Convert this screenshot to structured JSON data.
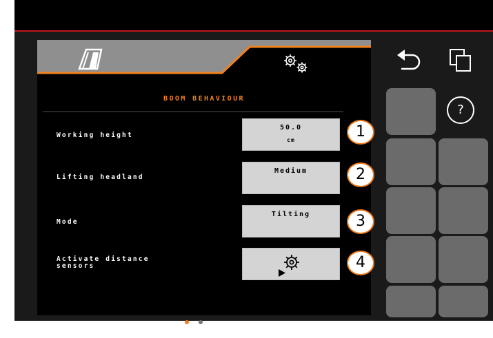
{
  "screen": {
    "title": "BOOM BEHAVIOUR",
    "accent_color": "#f0821e",
    "tabs": [
      {
        "icon": "boom-section-icon",
        "active": true
      },
      {
        "icon": "gears-icon",
        "active": false
      }
    ]
  },
  "settings": [
    {
      "label": "Working height",
      "value": "50.0",
      "unit": "cm",
      "callout": "1"
    },
    {
      "label": "Lifting headland",
      "value": "Medium",
      "callout": "2"
    },
    {
      "label": "Mode",
      "value": "Tilting",
      "callout": "3"
    },
    {
      "label": "Activate distance\nsensors",
      "icon": "gear-play-icon",
      "callout": "4"
    }
  ],
  "pagination": {
    "active_color": "#f0821e",
    "inactive_color": "#777777"
  },
  "sidebar": {
    "top_icons": [
      "back-arrow-icon",
      "copy-windows-icon"
    ],
    "help_icon": "help-question-icon",
    "help_text": "?"
  }
}
